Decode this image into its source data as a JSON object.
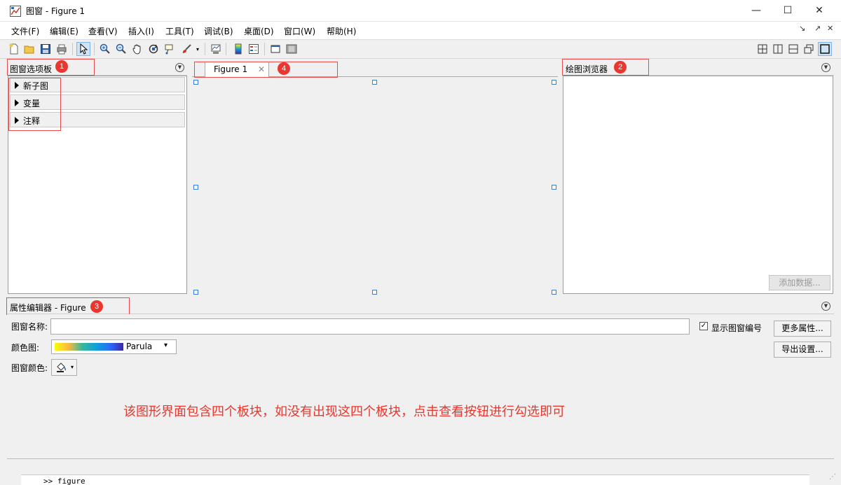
{
  "window": {
    "title": "图窗 - Figure 1"
  },
  "window_controls": {
    "minimize": "—",
    "maximize": "☐",
    "close": "✕"
  },
  "menu": {
    "items": [
      "文件(F)",
      "编辑(E)",
      "查看(V)",
      "插入(I)",
      "工具(T)",
      "调试(B)",
      "桌面(D)",
      "窗口(W)",
      "帮助(H)"
    ],
    "right": [
      "↘",
      "↗",
      "✕"
    ]
  },
  "toolbar": {
    "left_icons": [
      "new-figure-icon",
      "open-file-icon",
      "save-icon",
      "print-icon",
      "select-pointer-icon",
      "zoom-in-icon",
      "zoom-out-icon",
      "pan-hand-icon",
      "rotate-3d-icon",
      "data-cursor-icon",
      "brush-icon",
      "link-plot-icon",
      "colorbar-icon",
      "legend-icon",
      "hide-plot-tools-icon",
      "show-plot-tools-icon"
    ],
    "layout_icons": [
      "tile-grid-icon",
      "split-vertical-icon",
      "split-horizontal-icon",
      "float-icon",
      "maximize-icon"
    ]
  },
  "figure_palette": {
    "title": "图窗选项板",
    "badge": "1",
    "rows": [
      "新子图",
      "变量",
      "注释"
    ]
  },
  "figure_tab": {
    "label": "Figure 1",
    "badge": "4"
  },
  "plot_browser": {
    "title": "绘图浏览器",
    "badge": "2",
    "add_data": "添加数据..."
  },
  "property_editor": {
    "title": "属性编辑器 - Figure",
    "badge": "3",
    "figure_name_label": "图窗名称:",
    "figure_name_value": "",
    "show_number_label": "显示图窗编号",
    "show_number_checked": true,
    "more_props": "更多属性...",
    "export_setup": "导出设置...",
    "colormap_label": "颜色图:",
    "colormap_value": "Parula",
    "figure_color_label": "图窗颜色:"
  },
  "annotation_note": "该图形界面包含四个板块，如没有出现这四个板块，点击查看按钮进行勾选即可",
  "command_window": {
    "text": ">> figure"
  },
  "colors": {
    "accent_red": "#e8372f",
    "selection_blue": "#3b7fd4"
  }
}
